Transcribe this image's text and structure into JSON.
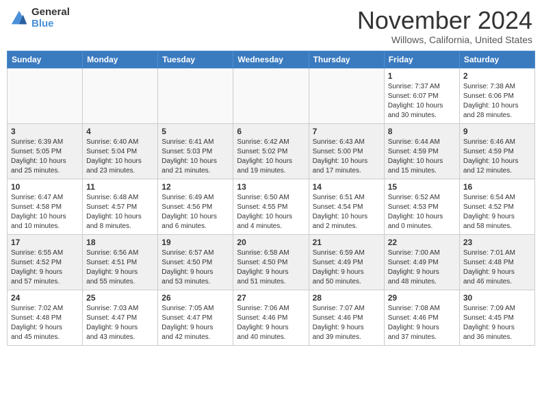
{
  "header": {
    "logo_general": "General",
    "logo_blue": "Blue",
    "month": "November 2024",
    "location": "Willows, California, United States"
  },
  "weekdays": [
    "Sunday",
    "Monday",
    "Tuesday",
    "Wednesday",
    "Thursday",
    "Friday",
    "Saturday"
  ],
  "weeks": [
    [
      {
        "day": "",
        "info": ""
      },
      {
        "day": "",
        "info": ""
      },
      {
        "day": "",
        "info": ""
      },
      {
        "day": "",
        "info": ""
      },
      {
        "day": "",
        "info": ""
      },
      {
        "day": "1",
        "info": "Sunrise: 7:37 AM\nSunset: 6:07 PM\nDaylight: 10 hours\nand 30 minutes."
      },
      {
        "day": "2",
        "info": "Sunrise: 7:38 AM\nSunset: 6:06 PM\nDaylight: 10 hours\nand 28 minutes."
      }
    ],
    [
      {
        "day": "3",
        "info": "Sunrise: 6:39 AM\nSunset: 5:05 PM\nDaylight: 10 hours\nand 25 minutes."
      },
      {
        "day": "4",
        "info": "Sunrise: 6:40 AM\nSunset: 5:04 PM\nDaylight: 10 hours\nand 23 minutes."
      },
      {
        "day": "5",
        "info": "Sunrise: 6:41 AM\nSunset: 5:03 PM\nDaylight: 10 hours\nand 21 minutes."
      },
      {
        "day": "6",
        "info": "Sunrise: 6:42 AM\nSunset: 5:02 PM\nDaylight: 10 hours\nand 19 minutes."
      },
      {
        "day": "7",
        "info": "Sunrise: 6:43 AM\nSunset: 5:00 PM\nDaylight: 10 hours\nand 17 minutes."
      },
      {
        "day": "8",
        "info": "Sunrise: 6:44 AM\nSunset: 4:59 PM\nDaylight: 10 hours\nand 15 minutes."
      },
      {
        "day": "9",
        "info": "Sunrise: 6:46 AM\nSunset: 4:59 PM\nDaylight: 10 hours\nand 12 minutes."
      }
    ],
    [
      {
        "day": "10",
        "info": "Sunrise: 6:47 AM\nSunset: 4:58 PM\nDaylight: 10 hours\nand 10 minutes."
      },
      {
        "day": "11",
        "info": "Sunrise: 6:48 AM\nSunset: 4:57 PM\nDaylight: 10 hours\nand 8 minutes."
      },
      {
        "day": "12",
        "info": "Sunrise: 6:49 AM\nSunset: 4:56 PM\nDaylight: 10 hours\nand 6 minutes."
      },
      {
        "day": "13",
        "info": "Sunrise: 6:50 AM\nSunset: 4:55 PM\nDaylight: 10 hours\nand 4 minutes."
      },
      {
        "day": "14",
        "info": "Sunrise: 6:51 AM\nSunset: 4:54 PM\nDaylight: 10 hours\nand 2 minutes."
      },
      {
        "day": "15",
        "info": "Sunrise: 6:52 AM\nSunset: 4:53 PM\nDaylight: 10 hours\nand 0 minutes."
      },
      {
        "day": "16",
        "info": "Sunrise: 6:54 AM\nSunset: 4:52 PM\nDaylight: 9 hours\nand 58 minutes."
      }
    ],
    [
      {
        "day": "17",
        "info": "Sunrise: 6:55 AM\nSunset: 4:52 PM\nDaylight: 9 hours\nand 57 minutes."
      },
      {
        "day": "18",
        "info": "Sunrise: 6:56 AM\nSunset: 4:51 PM\nDaylight: 9 hours\nand 55 minutes."
      },
      {
        "day": "19",
        "info": "Sunrise: 6:57 AM\nSunset: 4:50 PM\nDaylight: 9 hours\nand 53 minutes."
      },
      {
        "day": "20",
        "info": "Sunrise: 6:58 AM\nSunset: 4:50 PM\nDaylight: 9 hours\nand 51 minutes."
      },
      {
        "day": "21",
        "info": "Sunrise: 6:59 AM\nSunset: 4:49 PM\nDaylight: 9 hours\nand 50 minutes."
      },
      {
        "day": "22",
        "info": "Sunrise: 7:00 AM\nSunset: 4:49 PM\nDaylight: 9 hours\nand 48 minutes."
      },
      {
        "day": "23",
        "info": "Sunrise: 7:01 AM\nSunset: 4:48 PM\nDaylight: 9 hours\nand 46 minutes."
      }
    ],
    [
      {
        "day": "24",
        "info": "Sunrise: 7:02 AM\nSunset: 4:48 PM\nDaylight: 9 hours\nand 45 minutes."
      },
      {
        "day": "25",
        "info": "Sunrise: 7:03 AM\nSunset: 4:47 PM\nDaylight: 9 hours\nand 43 minutes."
      },
      {
        "day": "26",
        "info": "Sunrise: 7:05 AM\nSunset: 4:47 PM\nDaylight: 9 hours\nand 42 minutes."
      },
      {
        "day": "27",
        "info": "Sunrise: 7:06 AM\nSunset: 4:46 PM\nDaylight: 9 hours\nand 40 minutes."
      },
      {
        "day": "28",
        "info": "Sunrise: 7:07 AM\nSunset: 4:46 PM\nDaylight: 9 hours\nand 39 minutes."
      },
      {
        "day": "29",
        "info": "Sunrise: 7:08 AM\nSunset: 4:46 PM\nDaylight: 9 hours\nand 37 minutes."
      },
      {
        "day": "30",
        "info": "Sunrise: 7:09 AM\nSunset: 4:45 PM\nDaylight: 9 hours\nand 36 minutes."
      }
    ]
  ]
}
